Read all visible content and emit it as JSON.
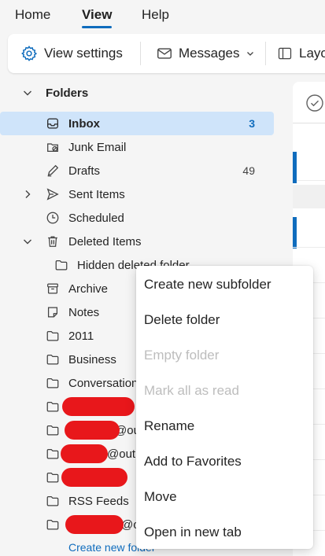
{
  "tabs": [
    {
      "label": "Home"
    },
    {
      "label": "View",
      "active": true
    },
    {
      "label": "Help"
    }
  ],
  "ribbon": {
    "view_settings": "View settings",
    "messages": "Messages",
    "layout": "Layo"
  },
  "folders": {
    "header": "Folders",
    "items": [
      {
        "label": "Inbox",
        "count": "3",
        "icon": "inbox-icon",
        "selected": true
      },
      {
        "label": "Junk Email",
        "icon": "junk-icon"
      },
      {
        "label": "Drafts",
        "count": "49",
        "icon": "drafts-icon"
      },
      {
        "label": "Sent Items",
        "icon": "send-icon"
      },
      {
        "label": "Scheduled",
        "icon": "clock-icon"
      },
      {
        "label": "Deleted Items",
        "icon": "trash-icon"
      },
      {
        "label": "Hidden deleted folder",
        "icon": "folder-icon"
      },
      {
        "label": "Archive",
        "icon": "archive-icon"
      },
      {
        "label": "Notes",
        "icon": "note-icon"
      },
      {
        "label": "2011",
        "icon": "folder-icon"
      },
      {
        "label": "Business",
        "icon": "folder-icon"
      },
      {
        "label": "Conversation",
        "icon": "folder-icon"
      },
      {
        "label": "",
        "icon": "folder-icon",
        "redacted": true
      },
      {
        "label": "@ou",
        "icon": "folder-icon",
        "redacted": true
      },
      {
        "label": "@outl",
        "icon": "folder-icon",
        "redacted": true
      },
      {
        "label": "",
        "icon": "folder-icon",
        "redacted": true
      },
      {
        "label": "RSS Feeds",
        "icon": "folder-icon"
      },
      {
        "label": "@o",
        "icon": "folder-icon",
        "redacted": true
      }
    ],
    "create_new_folder": "Create new folder"
  },
  "context_menu": {
    "items": [
      {
        "label": "Create new subfolder",
        "enabled": true
      },
      {
        "label": "Delete folder",
        "enabled": true
      },
      {
        "label": "Empty folder",
        "enabled": false
      },
      {
        "label": "Mark all as read",
        "enabled": false
      },
      {
        "label": "Rename",
        "enabled": true
      },
      {
        "label": "Add to Favorites",
        "enabled": true
      },
      {
        "label": "Move",
        "enabled": true
      },
      {
        "label": "Open in new tab",
        "enabled": true
      }
    ]
  },
  "colors": {
    "accent": "#0f6cbd",
    "selected_bg": "#cfe4fa",
    "redaction": "#e8171b"
  }
}
